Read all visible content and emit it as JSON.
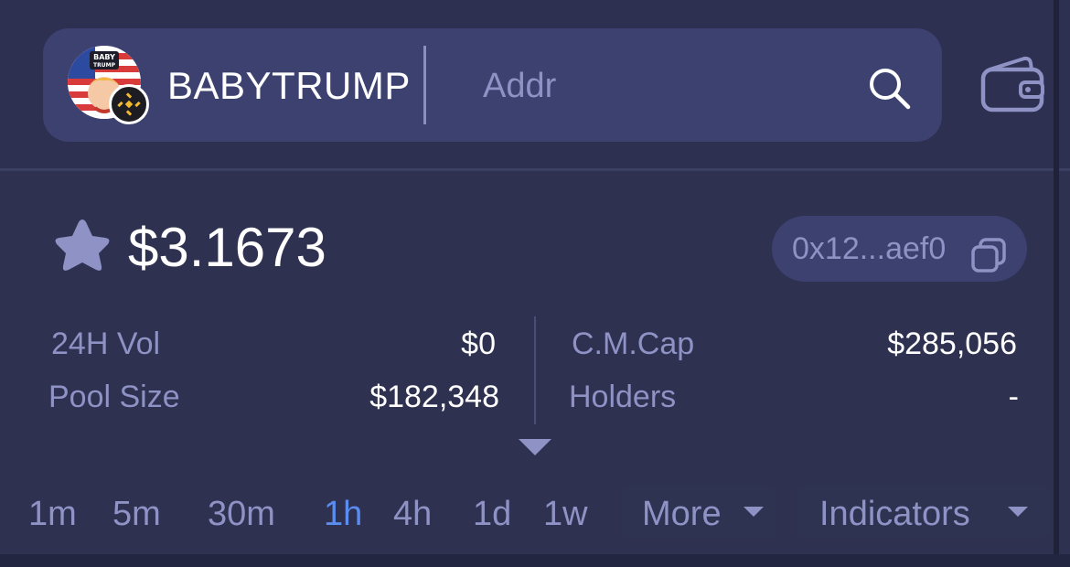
{
  "header": {
    "token_symbol": "BABYTRUMP",
    "logo_text_top": "BABY",
    "logo_text_bottom": "TRUMP",
    "search_placeholder": "Addr",
    "icons": {
      "search": "search-icon",
      "wallet": "wallet-icon",
      "chain": "bnb-chain-icon"
    }
  },
  "token": {
    "price": "$3.1673",
    "contract_short": "0x12...aef0",
    "favorite_icon": "star-icon",
    "copy_icon": "copy-icon"
  },
  "stats": {
    "vol_label": "24H Vol",
    "vol_value": "$0",
    "pool_label": "Pool Size",
    "pool_value": "$182,348",
    "mcap_label": "C.M.Cap",
    "mcap_value": "$285,056",
    "holders_label": "Holders",
    "holders_value": "-"
  },
  "timeframes": {
    "items": [
      "1m",
      "5m",
      "30m",
      "1h",
      "4h",
      "1d",
      "1w"
    ],
    "active": "1h",
    "more_label": "More",
    "indicators_label": "Indicators"
  },
  "colors": {
    "background": "#2e3150",
    "pill": "#3c4170",
    "muted_text": "#8e92c4",
    "active_tab": "#5b8df0",
    "bnb_yellow": "#f3ba2f"
  }
}
